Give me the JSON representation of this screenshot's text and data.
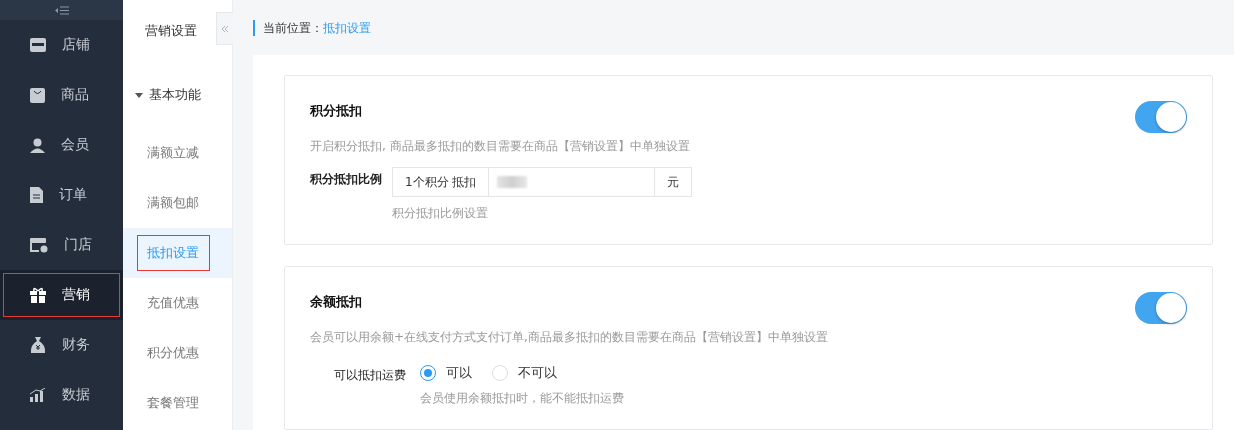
{
  "nav": {
    "items": [
      {
        "label": "店铺",
        "selected": false
      },
      {
        "label": "商品",
        "selected": false
      },
      {
        "label": "会员",
        "selected": false
      },
      {
        "label": "订单",
        "selected": false
      },
      {
        "label": "门店",
        "selected": false
      },
      {
        "label": "营销",
        "selected": true
      },
      {
        "label": "财务",
        "selected": false
      },
      {
        "label": "数据",
        "selected": false
      }
    ]
  },
  "subnav": {
    "title": "营销设置",
    "group": {
      "label": "基本功能",
      "expanded": true,
      "items": [
        {
          "label": "满额立减",
          "selected": false
        },
        {
          "label": "满额包邮",
          "selected": false
        },
        {
          "label": "抵扣设置",
          "selected": true
        },
        {
          "label": "充值优惠",
          "selected": false
        },
        {
          "label": "积分优惠",
          "selected": false
        },
        {
          "label": "套餐管理",
          "selected": false
        }
      ]
    }
  },
  "breadcrumb": {
    "label": "当前位置：",
    "current": "抵扣设置"
  },
  "sections": [
    {
      "kind": "ratio",
      "title": "积分抵扣",
      "on": true,
      "description": "开启积分抵扣, 商品最多抵扣的数目需要在商品【营销设置】中单独设置",
      "field_label": "积分抵扣比例",
      "prefix": "1个积分 抵扣",
      "suffix": "元",
      "hint": "积分抵扣比例设置"
    },
    {
      "kind": "radio",
      "title": "余额抵扣",
      "on": true,
      "description": "会员可以用余额+在线支付方式支付订单,商品最多抵扣的数目需要在商品【营销设置】中单独设置",
      "field_label": "可以抵扣运费",
      "options": [
        {
          "label": "可以",
          "selected": true
        },
        {
          "label": "不可以",
          "selected": false
        }
      ],
      "hint": "会员使用余额抵扣时，能不能抵扣运费"
    }
  ]
}
